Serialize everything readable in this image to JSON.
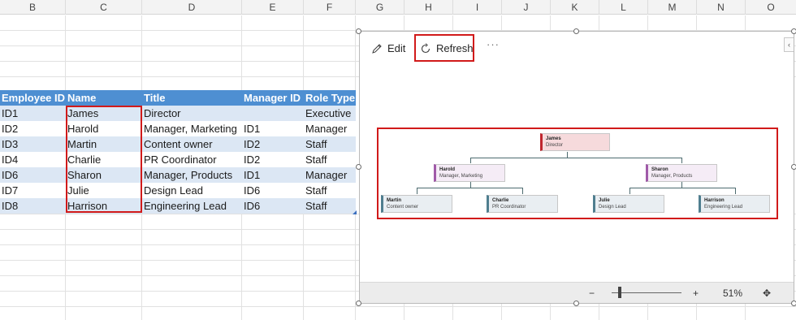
{
  "columns": [
    "B",
    "C",
    "D",
    "E",
    "F",
    "G",
    "H",
    "I",
    "J",
    "K",
    "L",
    "M",
    "N",
    "O"
  ],
  "table": {
    "headers": [
      "Employee ID",
      "Name",
      "Title",
      "Manager ID",
      "Role Type"
    ],
    "rows": [
      [
        "ID1",
        "James",
        "Director",
        "",
        "Executive"
      ],
      [
        "ID2",
        "Harold",
        "Manager, Marketing",
        "ID1",
        "Manager"
      ],
      [
        "ID3",
        "Martin",
        "Content owner",
        "ID2",
        "Staff"
      ],
      [
        "ID4",
        "Charlie",
        "PR Coordinator",
        "ID2",
        "Staff"
      ],
      [
        "ID6",
        "Sharon",
        "Manager, Products",
        "ID1",
        "Manager"
      ],
      [
        "ID7",
        "Julie",
        "Design Lead",
        "ID6",
        "Staff"
      ],
      [
        "ID8",
        "Harrison",
        "Engineering Lead",
        "ID6",
        "Staff"
      ]
    ]
  },
  "visual": {
    "toolbar": {
      "edit_label": "Edit",
      "refresh_label": "Refresh",
      "more_label": "···",
      "collapse_label": "‹"
    },
    "org_chart": {
      "nodes": [
        {
          "id": "ID1",
          "name": "James",
          "title": "Director",
          "role": "exec"
        },
        {
          "id": "ID2",
          "name": "Harold",
          "title": "Manager, Marketing",
          "role": "mgr"
        },
        {
          "id": "ID6",
          "name": "Sharon",
          "title": "Manager, Products",
          "role": "mgr"
        },
        {
          "id": "ID3",
          "name": "Martin",
          "title": "Content owner",
          "role": "staff"
        },
        {
          "id": "ID4",
          "name": "Charlie",
          "title": "PR Coordinator",
          "role": "staff"
        },
        {
          "id": "ID7",
          "name": "Julie",
          "title": "Design Lead",
          "role": "staff"
        },
        {
          "id": "ID8",
          "name": "Harrison",
          "title": "Engineering Lead",
          "role": "staff"
        }
      ]
    },
    "statusbar": {
      "zoom_out": "−",
      "zoom_in": "+",
      "zoom_level": "51%",
      "zoom_fraction": 0.51,
      "fit_icon": "✥"
    }
  },
  "colors": {
    "table_header": "#4e8fd2",
    "table_band": "#dce7f4",
    "highlight": "#d11a1a",
    "exec_accent": "#c0262e",
    "manager_accent": "#a05aa8",
    "staff_accent": "#4f7e8f"
  }
}
